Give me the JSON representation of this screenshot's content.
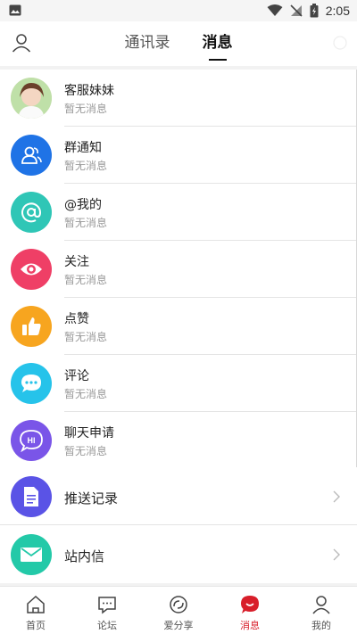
{
  "status": {
    "time": "2:05"
  },
  "header": {
    "tabs": [
      {
        "label": "通讯录",
        "active": false
      },
      {
        "label": "消息",
        "active": true
      }
    ]
  },
  "messages": [
    {
      "title": "客服妹妹",
      "subtitle": "暂无消息",
      "icon": "service-girl-avatar",
      "color": "#e9d8c8"
    },
    {
      "title": "群通知",
      "subtitle": "暂无消息",
      "icon": "group-icon",
      "color": "#1f73e6"
    },
    {
      "title": "@我的",
      "subtitle": "暂无消息",
      "icon": "at-icon",
      "color": "#2fc6b6"
    },
    {
      "title": "关注",
      "subtitle": "暂无消息",
      "icon": "eye-icon",
      "color": "#ef3f66"
    },
    {
      "title": "点赞",
      "subtitle": "暂无消息",
      "icon": "thumbs-up-icon",
      "color": "#f7a51f"
    },
    {
      "title": "评论",
      "subtitle": "暂无消息",
      "icon": "comment-icon",
      "color": "#26c3ea"
    },
    {
      "title": "聊天申请",
      "subtitle": "暂无消息",
      "icon": "hi-chat-icon",
      "color": "#7a55e8"
    }
  ],
  "links": [
    {
      "title": "推送记录",
      "icon": "document-icon",
      "color": "#5a53e6"
    },
    {
      "title": "站内信",
      "icon": "mail-icon",
      "color": "#23c9a8"
    }
  ],
  "tabbar": [
    {
      "label": "首页",
      "icon": "home-icon",
      "active": false
    },
    {
      "label": "论坛",
      "icon": "forum-icon",
      "active": false
    },
    {
      "label": "爱分享",
      "icon": "share-icon",
      "active": false
    },
    {
      "label": "消息",
      "icon": "message-icon",
      "active": true
    },
    {
      "label": "我的",
      "icon": "profile-icon",
      "active": false
    }
  ]
}
